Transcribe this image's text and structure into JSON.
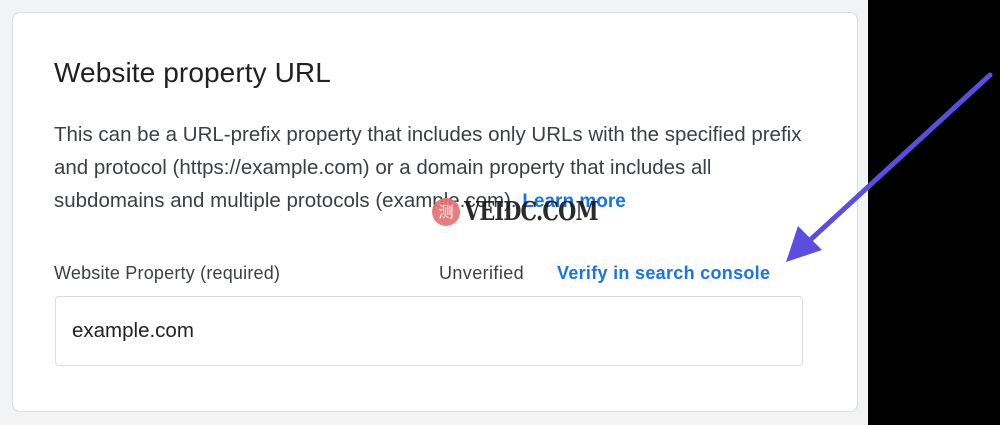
{
  "card": {
    "title": "Website property URL",
    "description": "This can be a URL-prefix property that includes only URLs with the specified prefix and protocol (https://example.com) or a domain property that includes all subdomains and multiple protocols (example.com).",
    "learn_more_label": "Learn more"
  },
  "field": {
    "label": "Website Property (required)",
    "status": "Unverified",
    "verify_link_label": "Verify in search console",
    "value": "example.com"
  },
  "watermark": {
    "logo_glyph": "测",
    "text": "VEIDC.COM"
  },
  "annotation": {
    "arrow_color": "#5b4de0",
    "target": "verify-link"
  },
  "colors": {
    "accent": "#1a73e8",
    "card_bg": "#ffffff",
    "page_bg": "#f1f3f4",
    "right_margin": "#000000"
  }
}
